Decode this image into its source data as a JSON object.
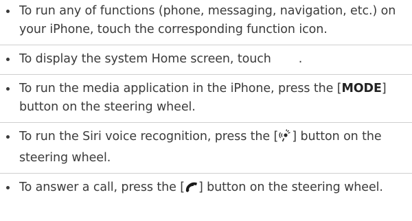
{
  "items": [
    {
      "text": "To run any of functions (phone, messaging, navigation, etc.) on your iPhone, touch the corresponding function icon."
    },
    {
      "before": "To display the system Home screen, touch",
      "after": "."
    },
    {
      "before": "To run the media application in the iPhone, press the [",
      "bold": "MODE",
      "after": "] button on the steering wheel."
    },
    {
      "before": "To run the Siri voice recognition, press the [",
      "icon": "voice-recognition-icon",
      "after": "] button on the steering wheel."
    },
    {
      "before": "To answer a call, press the [",
      "icon": "phone-call-icon",
      "after": "] button on the steering wheel."
    }
  ]
}
